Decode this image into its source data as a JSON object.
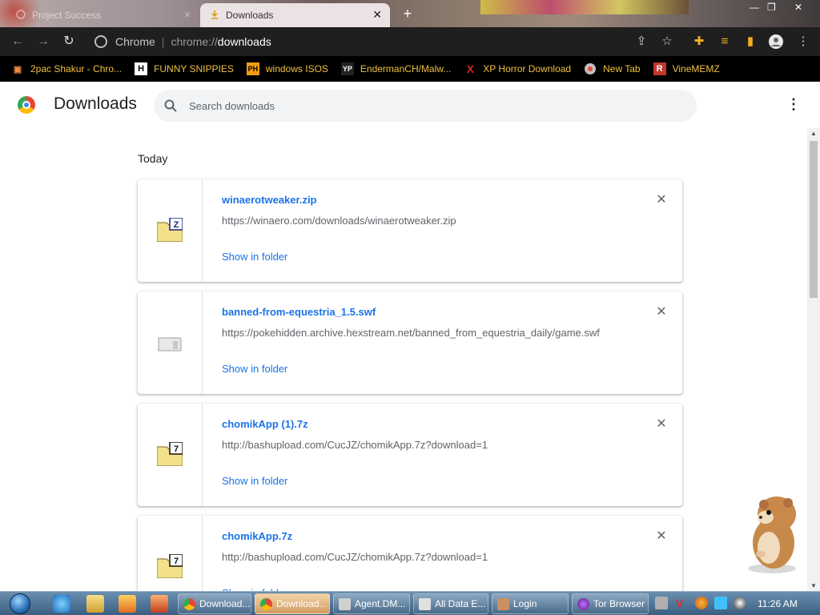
{
  "tabs": [
    {
      "title": "Project Success",
      "active": false
    },
    {
      "title": "Downloads",
      "active": true
    }
  ],
  "omnibox": {
    "chip": "Chrome",
    "scheme": "chrome://",
    "host": "downloads"
  },
  "bookmarks": [
    {
      "label": "2pac Shakur - Chro...",
      "icon": "bag-icon"
    },
    {
      "label": "FUNNY SNIPPIES",
      "icon": "H"
    },
    {
      "label": "windows ISOS",
      "icon": "PH"
    },
    {
      "label": "EndermanCH/Malw...",
      "icon": "YP"
    },
    {
      "label": "XP Horror Download",
      "icon": "X"
    },
    {
      "label": "New Tab",
      "icon": "globe-icon"
    },
    {
      "label": "VineMEMZ",
      "icon": "R"
    }
  ],
  "page": {
    "title": "Downloads",
    "search_placeholder": "Search downloads",
    "section": "Today",
    "show_in_folder": "Show in folder"
  },
  "downloads": [
    {
      "name": "winaerotweaker.zip",
      "url": "https://winaero.com/downloads/winaerotweaker.zip",
      "icon": "zip-folder-icon",
      "badge": "Z"
    },
    {
      "name": "banned-from-equestria_1.5.swf",
      "url": "https://pokehidden.archive.hexstream.net/banned_from_equestria_daily/game.swf",
      "icon": "generic-file-icon",
      "badge": ""
    },
    {
      "name": "chomikApp (1).7z",
      "url": "http://bashupload.com/CucJZ/chomikApp.7z?download=1",
      "icon": "7z-folder-icon",
      "badge": "7"
    },
    {
      "name": "chomikApp.7z",
      "url": "http://bashupload.com/CucJZ/chomikApp.7z?download=1",
      "icon": "7z-folder-icon",
      "badge": "7"
    }
  ],
  "taskbar": {
    "tasks": [
      {
        "label": "Download...",
        "active": false
      },
      {
        "label": "Download...",
        "active": true
      },
      {
        "label": "Agent.DM...",
        "active": false
      },
      {
        "label": "All Data E...",
        "active": false
      },
      {
        "label": "Login",
        "active": false
      },
      {
        "label": "Tor Browser",
        "active": false
      }
    ],
    "clock": "11:26 AM"
  },
  "colors": {
    "accent": "#1a73e8",
    "bookmark_text": "#f0c040",
    "toolbar_bg": "#1f1f1f"
  }
}
